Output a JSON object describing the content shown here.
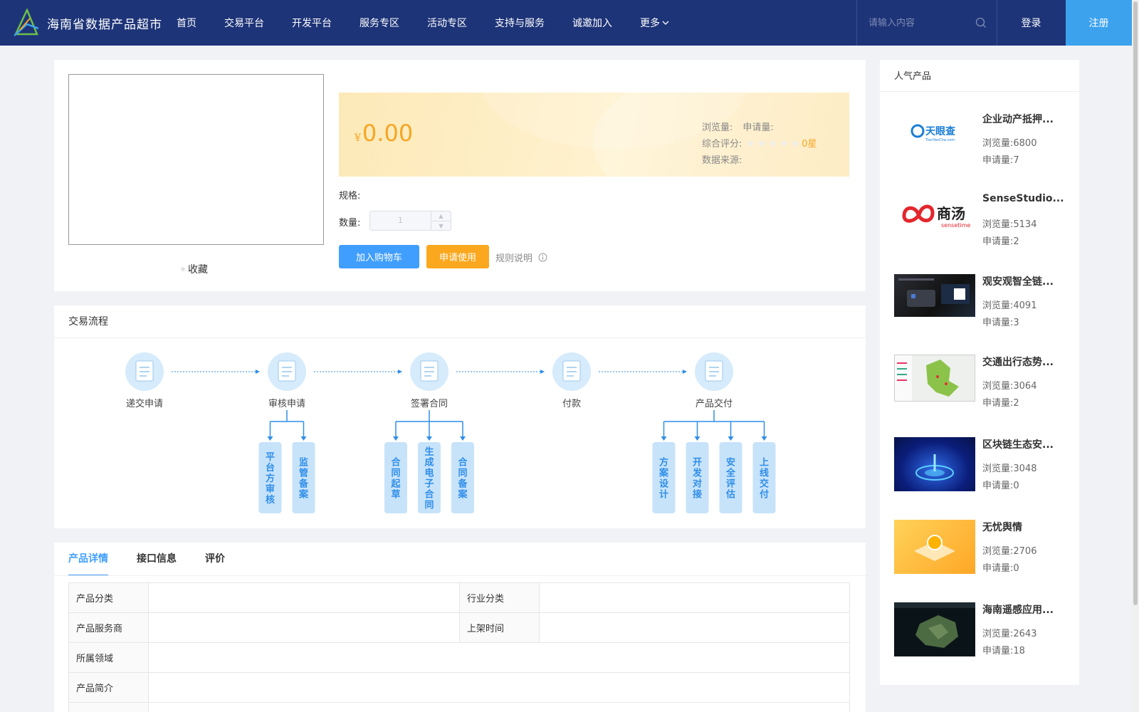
{
  "header": {
    "site_name": "海南省数据产品超市",
    "nav": [
      "首页",
      "交易平台",
      "开发平台",
      "服务专区",
      "活动专区",
      "支持与服务",
      "诚邀加入",
      "更多"
    ],
    "search_placeholder": "请输入内容",
    "login": "登录",
    "register": "注册"
  },
  "product": {
    "favorite": "收藏",
    "currency": "¥",
    "price": "0.00",
    "views_label": "浏览量:",
    "applications_label": "申请量:",
    "rating_label": "综合评分:",
    "rating_text": "0星",
    "rating_stars": 0,
    "source_label": "数据来源:",
    "spec_label": "规格:",
    "quantity_label": "数量:",
    "quantity_value": "1",
    "add_to_cart": "加入购物车",
    "apply_use": "申请使用",
    "rules": "规则说明"
  },
  "flow": {
    "title": "交易流程",
    "steps": [
      {
        "label": "递交申请",
        "subs": []
      },
      {
        "label": "审核申请",
        "subs": [
          "平台方审核",
          "监管备案"
        ]
      },
      {
        "label": "签署合同",
        "subs": [
          "合同起草",
          "生成电子合同",
          "合同备案"
        ]
      },
      {
        "label": "付款",
        "subs": []
      },
      {
        "label": "产品交付",
        "subs": [
          "方案设计",
          "开发对接",
          "安全评估",
          "上线交付"
        ]
      }
    ]
  },
  "tabs": {
    "items": [
      "产品详情",
      "接口信息",
      "评价"
    ],
    "active": 0
  },
  "details": {
    "category_label": "产品分类",
    "category_value": "",
    "industry_label": "行业分类",
    "industry_value": "",
    "provider_label": "产品服务商",
    "provider_value": "",
    "listed_label": "上架时间",
    "listed_value": "",
    "domain_label": "所属领域",
    "domain_value": "",
    "intro_label": "产品简介",
    "intro_value": ""
  },
  "popular": {
    "title": "人气产品",
    "views_label": "浏览量:",
    "applications_label": "申请量:",
    "items": [
      {
        "name": "企业动产抵押...",
        "views": "6800",
        "applications": "7",
        "thumb": "tianyancha-logo"
      },
      {
        "name": "SenseStudio...",
        "views": "5134",
        "applications": "2",
        "thumb": "sensetime-logo"
      },
      {
        "name": "观安观智全链...",
        "views": "4091",
        "applications": "3",
        "thumb": "device-photo"
      },
      {
        "name": "交通出行态势...",
        "views": "3064",
        "applications": "2",
        "thumb": "map-dashboard"
      },
      {
        "name": "区块链生态安...",
        "views": "3048",
        "applications": "0",
        "thumb": "blockchain-visual"
      },
      {
        "name": "无忧舆情",
        "views": "2706",
        "applications": "0",
        "thumb": "sentiment-visual"
      },
      {
        "name": "海南遥感应用...",
        "views": "2643",
        "applications": "18",
        "thumb": "satellite-map"
      }
    ],
    "logo_text": {
      "tianyancha": "天眼查",
      "tianyancha_sub": "TianYanCha.com",
      "sensetime_cn": "商汤",
      "sensetime_en": "sensetime"
    }
  },
  "colors": {
    "header_bg": "#1e3478",
    "primary": "#409eff",
    "accent_orange": "#fba81e",
    "price": "#f6a623",
    "register_bg": "#3ca2ee"
  }
}
